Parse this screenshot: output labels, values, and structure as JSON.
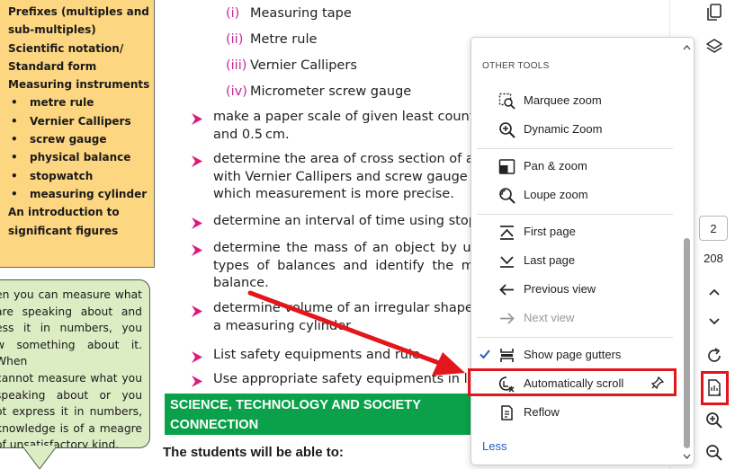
{
  "sidebar_box": {
    "lines": [
      {
        "text": "Prefixes (multiples and",
        "bullet": false
      },
      {
        "text": "sub-multiples)",
        "bullet": false
      },
      {
        "text": "Scientific notation/",
        "bullet": false
      },
      {
        "text": "Standard form",
        "bullet": false
      },
      {
        "text": "Measuring instruments",
        "bullet": false
      },
      {
        "text": "metre rule",
        "bullet": true
      },
      {
        "text": "Vernier Callipers",
        "bullet": true
      },
      {
        "text": "screw gauge",
        "bullet": true
      },
      {
        "text": "physical balance",
        "bullet": true
      },
      {
        "text": "stopwatch",
        "bullet": true
      },
      {
        "text": "measuring cylinder",
        "bullet": true
      },
      {
        "text": "An introduction to",
        "bullet": false
      },
      {
        "text": "significant figures",
        "bullet": false
      }
    ]
  },
  "quote": {
    "lines": [
      "en you can measure what",
      "are speaking about and",
      "ess it in numbers, you",
      "w something about it. When",
      "cannot measure what you",
      "speaking about or you",
      "ot express it in numbers,",
      "knowledge is of a meagre",
      "of unsatisfactory kind."
    ]
  },
  "content": {
    "sub_items": [
      {
        "num": "(i)",
        "text": "Measuring tape"
      },
      {
        "num": "(ii)",
        "text": "Metre rule"
      },
      {
        "num": "(iii)",
        "text": "Vernier Callipers"
      },
      {
        "num": "(iv)",
        "text": "Micrometer screw gauge"
      }
    ],
    "bullets": [
      {
        "lines": [
          "make a paper scale of given least count e",
          "and 0.5 cm."
        ]
      },
      {
        "lines": [
          "determine the area of cross section of a sol",
          "with Vernier Callipers and screw gauge and",
          "which measurement is more precise."
        ]
      },
      {
        "lines": [
          "determine an interval of time using stopwa"
        ]
      },
      {
        "lines": [
          "determine the mass of an object by using",
          "types of balances and identify the most",
          "balance."
        ]
      },
      {
        "lines": [
          "determine volume of an irregular shaped ob",
          "a measuring cylinder."
        ]
      },
      {
        "lines": [
          "List safety equipments and rule"
        ]
      },
      {
        "lines": [
          "Use appropriate safety equipments in labo"
        ]
      }
    ],
    "banner_lines": [
      "SCIENCE, TECHNOLOGY AND SOCIETY",
      "CONNECTION"
    ],
    "students_heading": "The students will be able to:"
  },
  "toolbar": {
    "page_current": "2",
    "page_total": "208",
    "icons": [
      "copy-pages-icon",
      "layers-icon",
      "chevron-up-icon",
      "chevron-down-icon",
      "rotate-icon",
      "other-tools-icon",
      "zoom-in-icon",
      "zoom-out-icon"
    ]
  },
  "menu": {
    "title": "OTHER TOOLS",
    "items": [
      {
        "label": "Marquee zoom",
        "icon": "marquee-zoom-icon"
      },
      {
        "label": "Dynamic Zoom",
        "icon": "dynamic-zoom-icon"
      },
      {
        "label": "Pan & zoom",
        "icon": "pan-zoom-icon"
      },
      {
        "label": "Loupe zoom",
        "icon": "loupe-zoom-icon"
      },
      {
        "label": "First page",
        "icon": "first-page-icon"
      },
      {
        "label": "Last page",
        "icon": "last-page-icon"
      },
      {
        "label": "Previous view",
        "icon": "previous-view-icon"
      },
      {
        "label": "Next view",
        "icon": "next-view-icon",
        "disabled": true
      },
      {
        "label": "Show page gutters",
        "icon": "page-gutters-icon",
        "checked": true
      },
      {
        "label": "Automatically scroll",
        "icon": "auto-scroll-icon",
        "pinned": true
      },
      {
        "label": "Reflow",
        "icon": "reflow-icon"
      }
    ],
    "less_label": "Less"
  },
  "colors": {
    "yellow_box": "#fdd681",
    "quote_bg": "#dcecc3",
    "banner_green": "#0aa14a",
    "sub_number_magenta": "#c52a96",
    "bullet_triangle_magenta": "#d81b7c",
    "annotation_red": "#e3161c",
    "link_blue": "#1f5fbf"
  }
}
